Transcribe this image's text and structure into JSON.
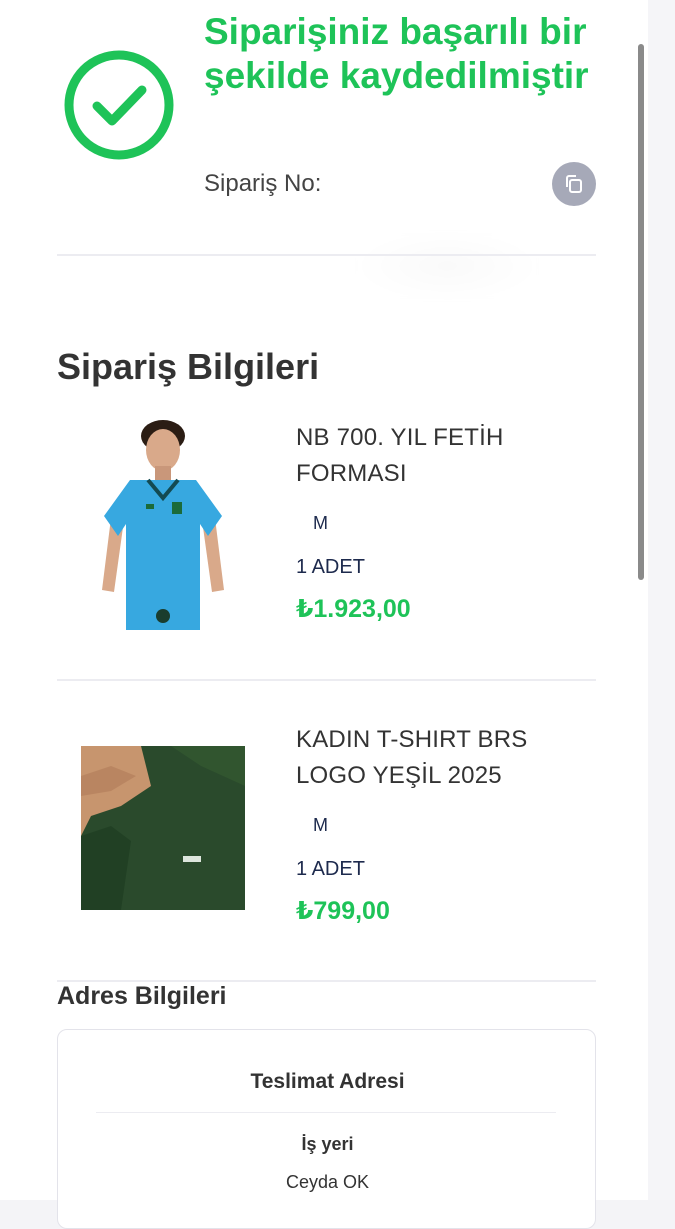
{
  "header": {
    "success_message": "Siparişiniz başarılı bir şekilde kaydedilmiştir",
    "order_no_label": "Sipariş No:",
    "copy_icon": "copy-icon",
    "success_icon": "check-circle-icon"
  },
  "order": {
    "section_title": "Sipariş Bilgileri",
    "items": [
      {
        "name": "NB 700. YIL FETİH FORMASI",
        "size": "M",
        "quantity": "1 ADET",
        "price": "₺1.923,00",
        "image": "light-blue-jersey-photo"
      },
      {
        "name": "KADIN T-SHIRT BRS LOGO YEŞİL 2025",
        "size": "M",
        "quantity": "1 ADET",
        "price": "₺799,00",
        "image": "green-tshirt-photo"
      }
    ]
  },
  "address": {
    "section_title": "Adres Bilgileri",
    "card_title": "Teslimat Adresi",
    "type": "İş yeri",
    "name": "Ceyda OK"
  },
  "colors": {
    "accent_green": "#1ec358",
    "text_dark": "#333333",
    "navy": "#1d2a4d",
    "copy_button_bg": "#a6a9b8"
  }
}
